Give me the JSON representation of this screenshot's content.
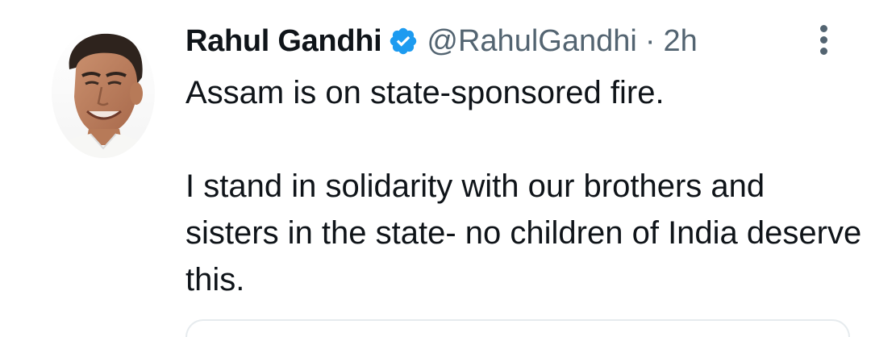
{
  "tweet": {
    "author": {
      "display_name": "Rahul Gandhi",
      "handle": "@RahulGandhi",
      "verified": true,
      "verified_icon": "verified-badge-icon"
    },
    "separator": "·",
    "time": "2h",
    "text": {
      "line1": "Assam is on state-sponsored fire.",
      "paragraph2": "I stand in solidarity with our brothers and sisters in the state- no children of India deserve this."
    },
    "more_icon": "more-vertical-icon"
  },
  "colors": {
    "text_primary": "#0f1419",
    "text_secondary": "#536471",
    "verified_blue": "#1d9bf0"
  }
}
